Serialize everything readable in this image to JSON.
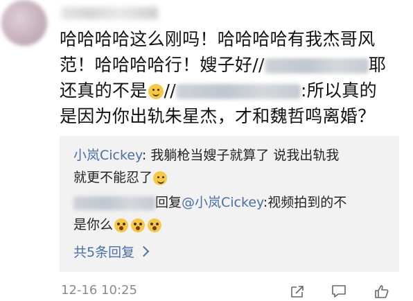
{
  "comment": {
    "line1": "哈哈哈哈这么刚吗！哈哈哈哈有我杰哥风",
    "line2_a": "范！哈哈哈哈行！嫂子好//",
    "line2_b": "耶",
    "line3_a": "还真的不是",
    "line3_b": "//",
    "line3_c": ":所以真的",
    "line4": "是因为你出轨朱星杰，才和魏哲鸣离婚？",
    "timestamp": "12-16 10:25"
  },
  "replies": {
    "reply1_author": "小岚Cickey",
    "reply1_text_a": ": 我躺枪当嫂子就算了 说我出轨我",
    "reply1_text_b": "就更不能忍了",
    "reply2_mid": "回复",
    "reply2_mention": "@小岚Cickey",
    "reply2_text_a": ":视频拍到的不",
    "reply2_text_b": "是你么",
    "more_label": "共5条回复"
  },
  "icons": {
    "share": "share-icon",
    "comment": "comment-icon",
    "like": "like-icon"
  },
  "colors": {
    "link": "#4a6fa5",
    "reply_bg": "#f2f2f2",
    "timestamp": "#8a8a8a"
  }
}
